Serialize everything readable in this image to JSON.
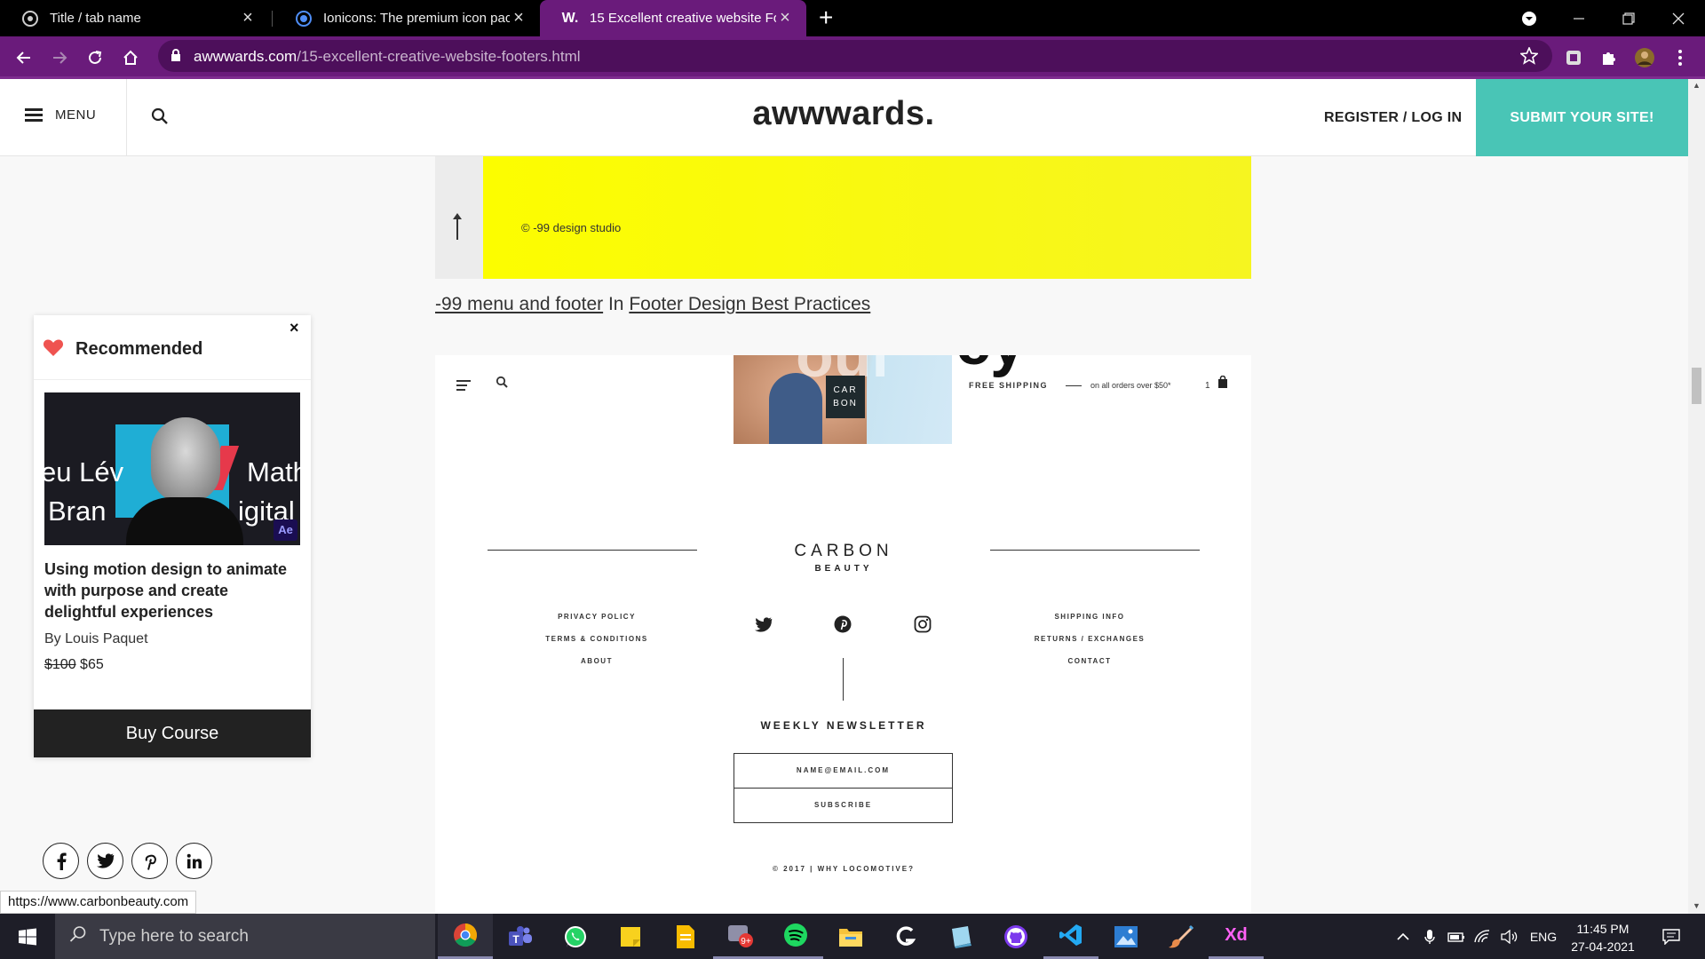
{
  "browser": {
    "tabs": [
      {
        "title": "Title / tab name",
        "active": false
      },
      {
        "title": "Ionicons: The premium icon pack",
        "active": false
      },
      {
        "title": "15 Excellent creative website Foo",
        "active": true
      }
    ],
    "new_tab": "+",
    "url_domain": "awwwards.com",
    "url_path": "/15-excellent-creative-website-footers.html"
  },
  "site": {
    "menu_label": "MENU",
    "logo": "awwwards.",
    "register_label": "REGISTER / LOG IN",
    "submit_label": "SUBMIT YOUR SITE!"
  },
  "article": {
    "studio_text": "© -99 design studio",
    "caption_link1": "-99 menu and footer",
    "caption_in": "In",
    "caption_link2": "Footer Design Best Practices",
    "carbon": {
      "badge_line1": "CAR",
      "badge_line2": "BON",
      "big_text": "ey",
      "hero_text": "oul",
      "free_shipping": "FREE SHIPPING",
      "orders_note": "on all orders over $50*",
      "cart_qty": "1",
      "brand": "CARBON",
      "brand_sub": "BEAUTY",
      "left_links": [
        "PRIVACY POLICY",
        "TERMS & CONDITIONS",
        "ABOUT"
      ],
      "right_links": [
        "SHIPPING INFO",
        "RETURNS / EXCHANGES",
        "CONTACT"
      ],
      "newsletter_title": "WEEKLY NEWSLETTER",
      "email_placeholder": "NAME@EMAIL.COM",
      "subscribe_label": "SUBSCRIBE",
      "copyright": "© 2017 | WHY LOCOMOTIVE?"
    }
  },
  "recommended": {
    "title": "Recommended",
    "close": "×",
    "thumb_texts": [
      "eu Lév",
      "Math",
      "Bran",
      "igital"
    ],
    "thumb_badge": "Ae",
    "course_title": "Using motion design to animate with purpose and create delightful experiences",
    "author": "By Louis Paquet",
    "old_price": "$100",
    "new_price": "$65",
    "buy_label": "Buy Course"
  },
  "status_url": "https://www.carbonbeauty.com",
  "taskbar": {
    "search_placeholder": "Type here to search",
    "language": "ENG",
    "time": "11:45 PM",
    "date": "27-04-2021",
    "badge_count": "9+"
  },
  "colors": {
    "browser_accent": "#6a1b7b",
    "submit_teal": "#49c5b6",
    "yellow": "#fcfd00"
  }
}
